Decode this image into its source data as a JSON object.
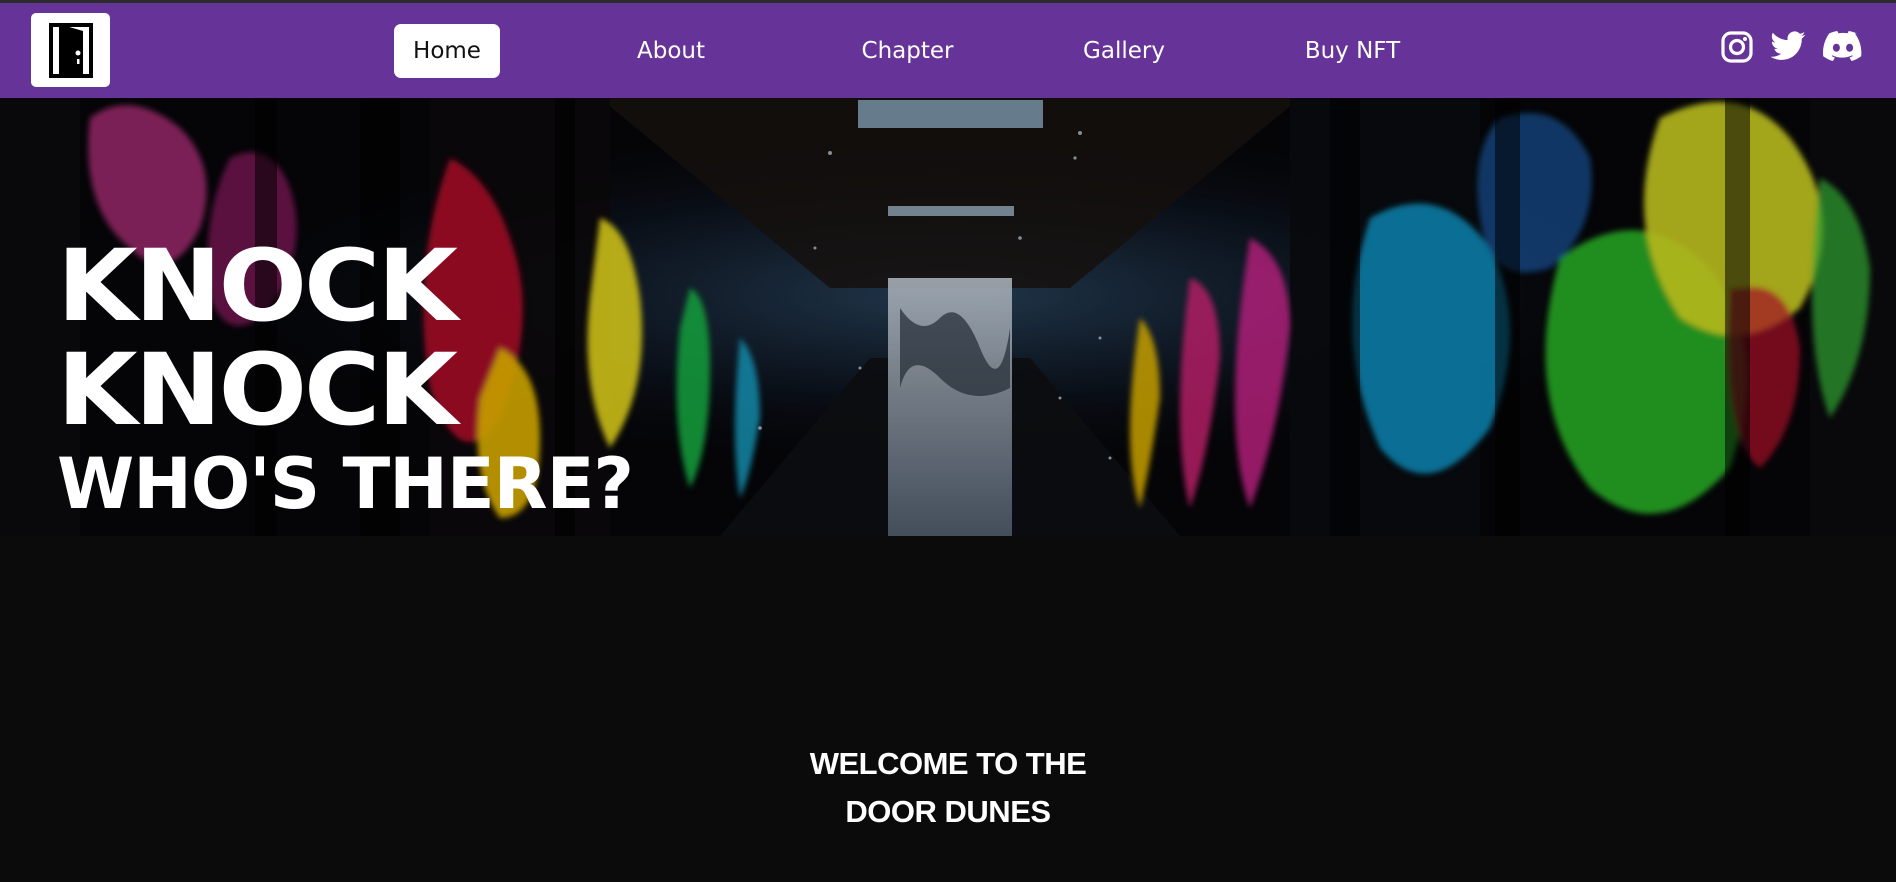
{
  "nav": {
    "logo": {
      "icon": "door-icon"
    },
    "items": [
      {
        "label": "Home",
        "active": true
      },
      {
        "label": "About",
        "active": false
      },
      {
        "label": "Chapter",
        "active": false
      },
      {
        "label": "Gallery",
        "active": false
      },
      {
        "label": "Buy NFT",
        "active": false
      }
    ],
    "socials": [
      {
        "icon": "instagram-icon"
      },
      {
        "icon": "twitter-icon"
      },
      {
        "icon": "discord-icon"
      }
    ],
    "bg_color": "#663399"
  },
  "hero": {
    "line1": "KNOCK",
    "line2": "KNOCK",
    "line3": "WHO'S THERE?"
  },
  "welcome": {
    "line1": "WELCOME TO THE",
    "line2": "DOOR DUNES"
  }
}
